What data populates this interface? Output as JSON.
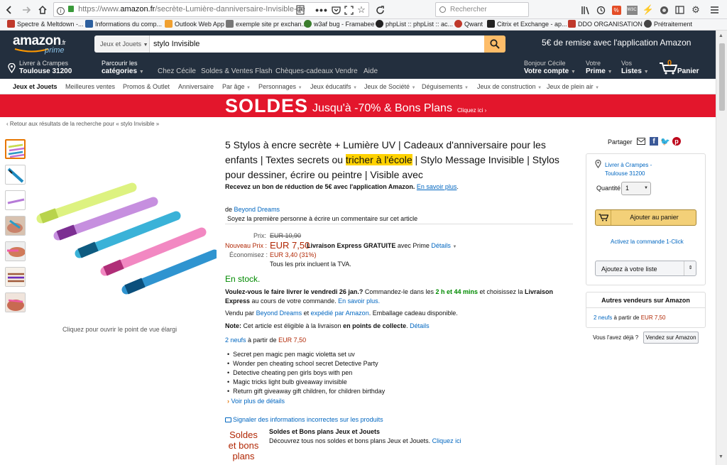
{
  "browser": {
    "url_prefix": "https://www.",
    "url_domain": "amazon.fr",
    "url_rest": "/secrète-Lumière-danniversaire-Invisible-de",
    "search_placeholder": "Rechercher",
    "bookmarks": [
      {
        "label": "Spectre & Meltdown -...",
        "icon_color": "#c0392b"
      },
      {
        "label": "Informations du comp...",
        "icon_color": "#2c5f9e"
      },
      {
        "label": "Outlook Web App",
        "icon_color": "#f0a030"
      },
      {
        "label": "exemple site pr exchan...",
        "icon_color": "#777777"
      },
      {
        "label": "w3af bug - Framabee",
        "icon_color": "#3a7d2c"
      },
      {
        "label": "phpList :: phpList :: ac...",
        "icon_color": "#222222"
      },
      {
        "label": "Qwant",
        "icon_color": "#c0392b"
      },
      {
        "label": "Citrix et Exchange - ap...",
        "icon_color": "#222222"
      },
      {
        "label": "DDO ORGANISATION ...",
        "icon_color": "#c0392b"
      },
      {
        "label": "Prétraitement",
        "icon_color": "#444444"
      }
    ]
  },
  "header": {
    "logo": "amazon",
    "logo_suffix": ".fr",
    "prime_tag": "prime",
    "search_category": "Jeux et Jouets",
    "search_value": "stylo Invisible",
    "promo": "5€ de remise avec l'application Amazon",
    "deliver_line1": "Livrer à Crampes",
    "deliver_line2": "Toulouse 31200",
    "browse_line1": "Parcourir les",
    "browse_line2": "catégories",
    "nav_links": [
      "Chez Cécile",
      "Soldes & Ventes Flash",
      "Chèques-cadeaux",
      "Vendre",
      "Aide"
    ],
    "account_line1": "Bonjour Cécile",
    "account_line2": "Votre compte",
    "prime_line1": "Votre",
    "prime_line2": "Prime",
    "lists_line1": "Vos",
    "lists_line2": "Listes",
    "cart_count": "0",
    "cart_label": "Panier"
  },
  "subnav": [
    "Jeux et Jouets",
    "Meilleures ventes",
    "Promos & Outlet",
    "Anniversaire",
    "Par âge",
    "Personnages",
    "Jeux éducatifs",
    "Jeux de Société",
    "Déguisements",
    "Jeux de construction",
    "Jeux de plein air"
  ],
  "banner": {
    "big": "SOLDES",
    "mid": "Jusqu'à -70% & Bons Plans",
    "small": "Cliquez ici ›"
  },
  "breadcrumb": "‹ Retour aux résultats de la recherche pour « stylo Invisible »",
  "image_caption": "Cliquez pour ouvrir le point de vue élargi",
  "product": {
    "title_before": "5 Stylos à encre secrète + Lumière UV | Cadeaux d'anniversaire pour les enfants | Textes secrets ou ",
    "title_highlight": "tricher à l'école",
    "title_after": " | Stylo Message Invisible | Stylos pour dessiner, écrire ou peintre | Visible avec",
    "app_offer": "Recevez un bon de réduction de 5€ avec l'application Amazon.",
    "app_offer_link": "En savoir plus",
    "by": "de",
    "brand": "Beyond Dreams",
    "review_link": "Soyez la première personne à écrire un commentaire sur cet article",
    "price_label": "Prix:",
    "price_old": "EUR 10,90",
    "new_price_label": "Nouveau Prix :",
    "new_price": "EUR 7,50",
    "delivery": "Livraison Express GRATUITE",
    "delivery_suffix": "avec Prime",
    "details": "Détails",
    "savings_label": "Économisez :",
    "savings": "EUR 3,40 (31%)",
    "tva": "Tous les prix incluent la TVA.",
    "stock": "En stock.",
    "ship_q": "Voulez-vous le faire livrer le vendredi 26 jan.?",
    "ship_mid": " Commandez-le dans les ",
    "ship_time": "2 h et 44 mins",
    "ship_mid2": " et choisissez la ",
    "ship_express": "Livraison Express",
    "ship_end": " au cours de votre commande.",
    "ship_link": "En savoir plus.",
    "sold_by": "Vendu par",
    "sold_by_brand": "Beyond Dreams",
    "sold_mid": "et",
    "shipped_by": "expédié par Amazon",
    "gift": ". Emballage cadeau disponible.",
    "note_label": "Note:",
    "note_text": " Cet article est éligible à la livraison ",
    "note_bold": "en points de collecte",
    "note_link": "Détails",
    "new_offers": "2 neufs",
    "from_text": " à partir de ",
    "from_price": "EUR 7,50",
    "bullets": [
      "Secret pen magic pen magic violetta set uv",
      "Wonder pen cheating school secret Detective Party",
      "Detective cheating pen girls boys with pen",
      "Magic tricks light bulb giveaway invisible",
      "Return gift giveaway gift children, for children birthday"
    ],
    "more_details": "Voir plus de détails",
    "report": "Signaler des informations incorrectes sur les produits",
    "soldes_img_text": "Soldes et bons plans",
    "soldes_title": "Soldes et Bons plans Jeux et Jouets",
    "soldes_text": "Découvrez tous nos soldes et bons plans Jeux et Jouets.",
    "soldes_link": "Cliquez ici"
  },
  "buybox": {
    "share": "Partager",
    "deliver_to": "Livrer à Crampes -",
    "deliver_city": "Toulouse 31200",
    "qty_label": "Quantité :",
    "qty_value": "1",
    "add_to_cart": "Ajouter au panier",
    "one_click": "Activez la commande 1-Click",
    "add_to_list": "Ajoutez à votre liste",
    "other_sellers_title": "Autres vendeurs sur Amazon",
    "other_new": "2 neufs",
    "other_from": " à partir de ",
    "other_price": "EUR 7,50",
    "have_one": "Vous l'avez déjà ?",
    "sell_button": "Vendez sur Amazon"
  },
  "colors": {
    "header_bg": "#232f3e",
    "banner_bg": "#e3162c",
    "link": "#0066c0",
    "price_red": "#b12704",
    "stock_green": "#008a00",
    "cart_button": "#f3d078"
  }
}
